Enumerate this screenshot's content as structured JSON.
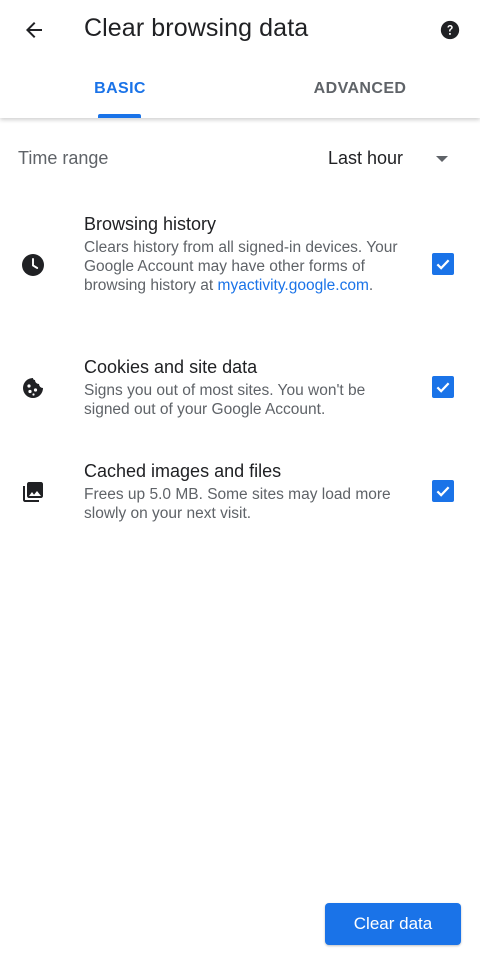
{
  "header": {
    "title": "Clear browsing data",
    "back_icon": "arrow-back-icon",
    "help_icon": "help-icon"
  },
  "tabs": [
    {
      "label": "BASIC",
      "selected": true
    },
    {
      "label": "ADVANCED",
      "selected": false
    }
  ],
  "time_range": {
    "label": "Time range",
    "value": "Last hour"
  },
  "items": [
    {
      "title": "Browsing history",
      "description": "Clears history from all signed-in devices. Your Google Account may have other forms of browsing history at",
      "link": "myactivity.google.com",
      "link_suffix": ".",
      "icon": "clock-icon",
      "checked": true
    },
    {
      "title": "Cookies and site data",
      "description": "Signs you out of most sites. You won't be signed out of your Google Account.",
      "icon": "cookie-icon",
      "checked": true
    },
    {
      "title": "Cached images and files",
      "description": "Frees up 5.0 MB. Some sites may load more slowly on your next visit.",
      "icon": "images-icon",
      "checked": true
    }
  ],
  "actions": {
    "clear_label": "Clear data"
  },
  "colors": {
    "accent": "#1a73e8",
    "text_primary": "#202124",
    "text_secondary": "#5f6368"
  }
}
